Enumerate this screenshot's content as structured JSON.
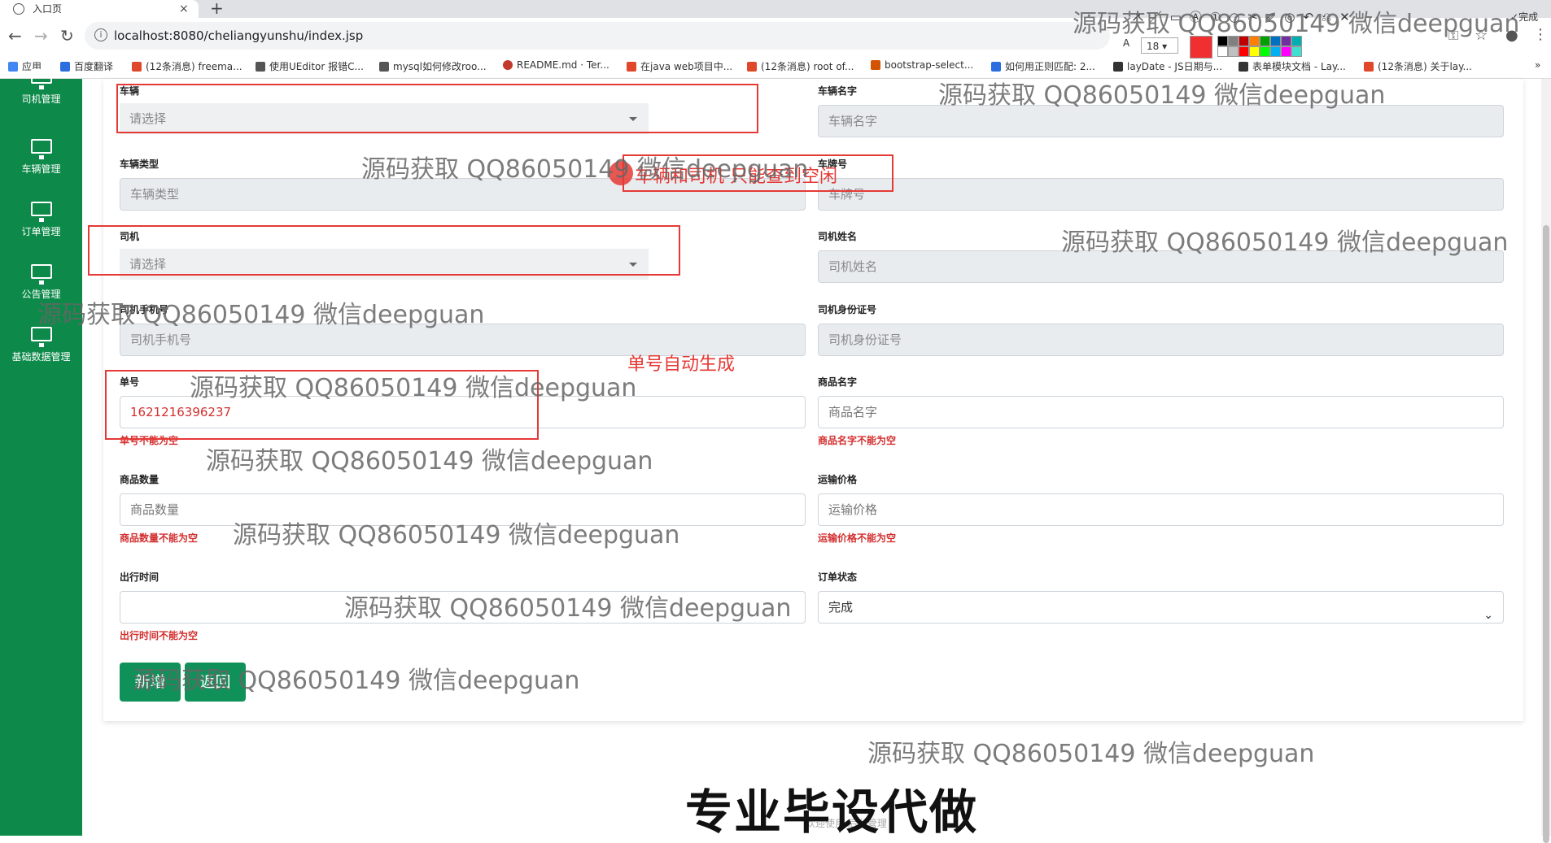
{
  "browser": {
    "tab_title": "入口页",
    "tab_close": "×",
    "new_tab": "+",
    "url": "localhost:8080/cheliangyunshu/index.jsp",
    "bookmarks": [
      "应用",
      "百度翻译",
      "(12条消息) freema...",
      "使用UEditor 报错C...",
      "mysql如何修改roo...",
      "README.md · Ter...",
      "在java web项目中...",
      "(12条消息) root of...",
      "bootstrap-select...",
      "如何用正则匹配: 2...",
      "layDate - JS日期与...",
      "表单模块文档 - Lay...",
      "(12条消息) 关于lay..."
    ]
  },
  "drawtool": {
    "font_icon": "A",
    "font_size": "18",
    "done_label": "完成",
    "current_color": "#f03030",
    "swatches": [
      "#000000",
      "#808080",
      "#c00000",
      "#ff8000",
      "#00a000",
      "#0070c0",
      "#7030a0",
      "#00b0b0",
      "#ffffff",
      "#c0c0c0",
      "#ff0000",
      "#ffff00",
      "#00ff00",
      "#00b0f0",
      "#ff00ff",
      "#40e0d0"
    ]
  },
  "sidebar": {
    "items": [
      {
        "label": "司机管理",
        "icon": "monitor-icon"
      },
      {
        "label": "车辆管理",
        "icon": "monitor-icon"
      },
      {
        "label": "订单管理",
        "icon": "monitor-icon"
      },
      {
        "label": "公告管理",
        "icon": "monitor-icon"
      },
      {
        "label": "基础数据管理",
        "icon": "monitor-icon"
      }
    ]
  },
  "form": {
    "vehicle": {
      "label": "车辆",
      "placeholder": "请选择"
    },
    "vehicle_name": {
      "label": "车辆名字",
      "placeholder": "车辆名字"
    },
    "vehicle_type": {
      "label": "车辆类型",
      "placeholder": "车辆类型"
    },
    "plate": {
      "label": "车牌号",
      "placeholder": "车牌号"
    },
    "driver": {
      "label": "司机",
      "placeholder": "请选择"
    },
    "driver_name": {
      "label": "司机姓名",
      "placeholder": "司机姓名"
    },
    "driver_phone": {
      "label": "司机手机号",
      "placeholder": "司机手机号"
    },
    "driver_id": {
      "label": "司机身份证号",
      "placeholder": "司机身份证号"
    },
    "order_no": {
      "label": "单号",
      "value": "1621216396237",
      "error": "单号不能为空"
    },
    "goods_name": {
      "label": "商品名字",
      "placeholder": "商品名字",
      "error": "商品名字不能为空"
    },
    "goods_qty": {
      "label": "商品数量",
      "placeholder": "商品数量",
      "error": "商品数量不能为空"
    },
    "price": {
      "label": "运输价格",
      "placeholder": "运输价格",
      "error": "运输价格不能为空"
    },
    "depart_time": {
      "label": "出行时间",
      "value": "",
      "error": "出行时间不能为空"
    },
    "order_status": {
      "label": "订单状态",
      "value": "完成"
    },
    "add_button": "新增",
    "back_button": "返回"
  },
  "annotations": {
    "idle_note": "车辆和司机 只能查到空闲",
    "auto_note": "单号自动生成"
  },
  "watermark": "源码获取 QQ86050149 微信deepguan",
  "banner": "专业毕设代做",
  "footer": "欢迎使用 后台管理"
}
